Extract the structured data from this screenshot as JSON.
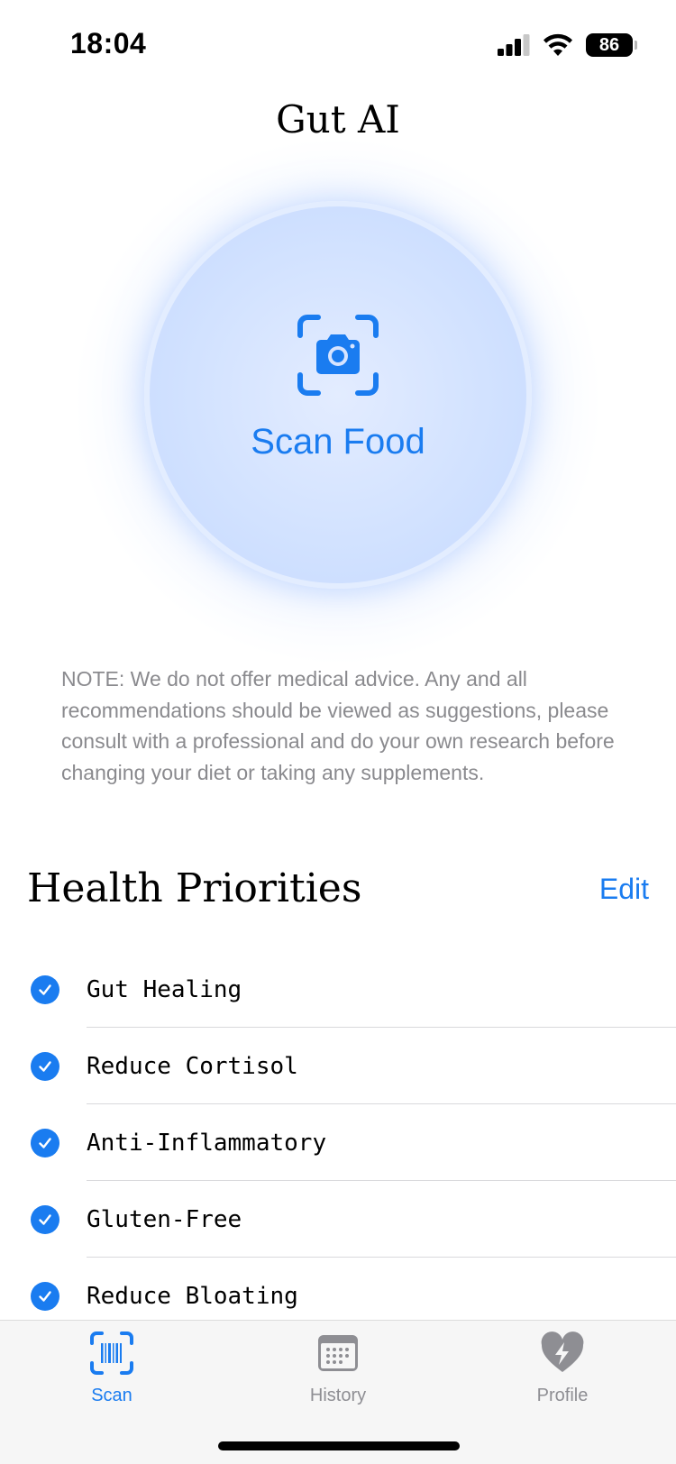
{
  "status": {
    "time": "18:04",
    "battery": "86"
  },
  "app": {
    "title": "Gut AI"
  },
  "scan": {
    "label": "Scan Food",
    "accent": "#1a7cf0"
  },
  "note": {
    "text": "NOTE: We do not offer medical advice. Any and all recommendations should be viewed as suggestions, please consult with a professional and do your own research before changing your diet or taking any supplements."
  },
  "priorities": {
    "title": "Health Priorities",
    "edit_label": "Edit",
    "items": [
      {
        "label": "Gut Healing",
        "checked": true
      },
      {
        "label": "Reduce Cortisol",
        "checked": true
      },
      {
        "label": "Anti-Inflammatory",
        "checked": true
      },
      {
        "label": "Gluten-Free",
        "checked": true
      },
      {
        "label": "Reduce Bloating",
        "checked": true
      }
    ]
  },
  "tabs": [
    {
      "label": "Scan",
      "icon": "barcode-scan-icon",
      "active": true
    },
    {
      "label": "History",
      "icon": "calendar-icon",
      "active": false
    },
    {
      "label": "Profile",
      "icon": "heart-bolt-icon",
      "active": false
    }
  ]
}
